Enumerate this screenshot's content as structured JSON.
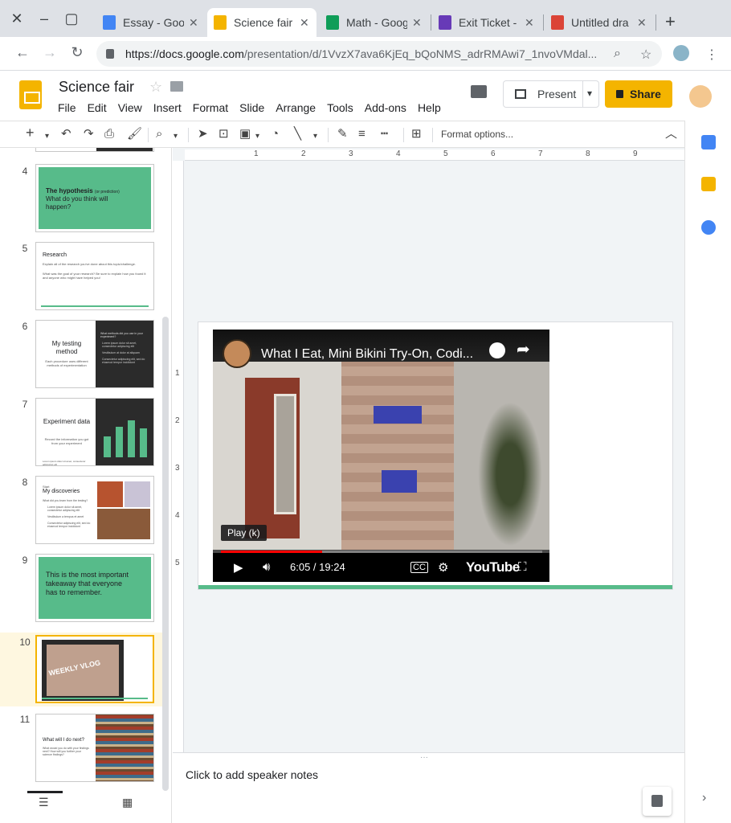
{
  "browser": {
    "tabs": [
      {
        "label": "Essay - Goo",
        "icon_color": "#4285f4"
      },
      {
        "label": "Science fair",
        "icon_color": "#f4b400",
        "active": true
      },
      {
        "label": "Math - Goog",
        "icon_color": "#0f9d58"
      },
      {
        "label": "Exit Ticket -",
        "icon_color": "#673ab7"
      },
      {
        "label": "Untitled dra",
        "icon_color": "#db4437"
      }
    ],
    "url_host": "https://docs.google.com",
    "url_path": "/presentation/d/1VvzX7ava6KjEq_bQoNMS_adrRMAwi7_1nvoVMdal..."
  },
  "app": {
    "title": "Science fair",
    "menu": [
      "File",
      "Edit",
      "View",
      "Insert",
      "Format",
      "Slide",
      "Arrange",
      "Tools",
      "Add-ons",
      "Help"
    ],
    "present_label": "Present",
    "share_label": "Share",
    "format_options_label": "Format options..."
  },
  "filmstrip": {
    "slides": [
      {
        "num": "4",
        "title": "The hypothesis",
        "title_suffix": "(or prediction)",
        "body": "What do you think will happen?"
      },
      {
        "num": "5",
        "title": "Research",
        "body": "Explain all of the research you've done about this topic/challenge.",
        "body2": "What was the goal of your research? Be sure to explain how you found it and anyone who might have helped you!"
      },
      {
        "num": "6",
        "title": "My testing method",
        "body": "Each procedure uses different methods of experimentation",
        "panel_title": "What methods did you use in your experiment?",
        "panel_items": [
          "Lorem ipsum dolor sit amet, consectetur adipiscing elit",
          "Vestibulum at dolor at aliquam",
          "Consectetur adipiscing elit, sed do eiusmod tempor incididunt"
        ]
      },
      {
        "num": "7",
        "title": "Experiment data",
        "body": "Record the information you got from your experiment",
        "footer": "Lorem ipsum dolor sit amet, consectetur adipiscing elit"
      },
      {
        "num": "8",
        "kicker": "Start",
        "title": "My discoveries",
        "body": "What did you learn from the testing?",
        "items": [
          "Lorem ipsum dolor sit amet, consectetur adipiscing elit",
          "Vestibulum a tempus et amet",
          "Consectetur adipiscing elit, sed do eiusmod tempor incididunt"
        ]
      },
      {
        "num": "9",
        "body": "This is the most important takeaway that everyone has to remember."
      },
      {
        "num": "10",
        "thumb_caption": "WEEKLY VLOG"
      },
      {
        "num": "11",
        "title": "What will I do next?",
        "body": "What would you do with your findings next? How will you further your science findings?"
      }
    ]
  },
  "ruler": {
    "h_labels": [
      "1",
      "2",
      "3",
      "4",
      "5",
      "6",
      "7",
      "8",
      "9"
    ],
    "v_labels": [
      "1",
      "2",
      "3",
      "4",
      "5"
    ]
  },
  "video": {
    "title": "What I Eat, Mini Bikini Try-On, Codi...",
    "tooltip": "Play (k)",
    "time": "6:05 / 19:24",
    "progress_fraction": 0.315,
    "brand": "YouTube"
  },
  "notes": {
    "placeholder": "Click to add speaker notes"
  },
  "colors": {
    "accent": "#f4b400",
    "slide_green": "#57bb8a",
    "progress_red": "#ff0000"
  }
}
